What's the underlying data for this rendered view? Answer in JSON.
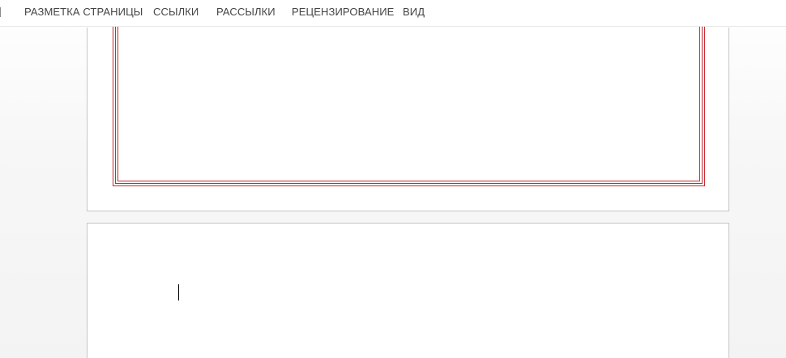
{
  "ribbon": {
    "tabs": [
      {
        "label": "РАЗМЕТКА СТРАНИЦЫ"
      },
      {
        "label": "ССЫЛКИ"
      },
      {
        "label": "РАССЫЛКИ"
      },
      {
        "label": "РЕЦЕНЗИРОВАНИЕ"
      },
      {
        "label": "ВИД"
      }
    ]
  },
  "document": {
    "pages": [
      {
        "page_border": "triple-line",
        "border_color": "#c42b2f"
      },
      {
        "has_cursor": true
      }
    ]
  },
  "colors": {
    "tab_text": "#444444",
    "page_border": "#c42b2f",
    "page_edge": "#c6c6c6"
  }
}
